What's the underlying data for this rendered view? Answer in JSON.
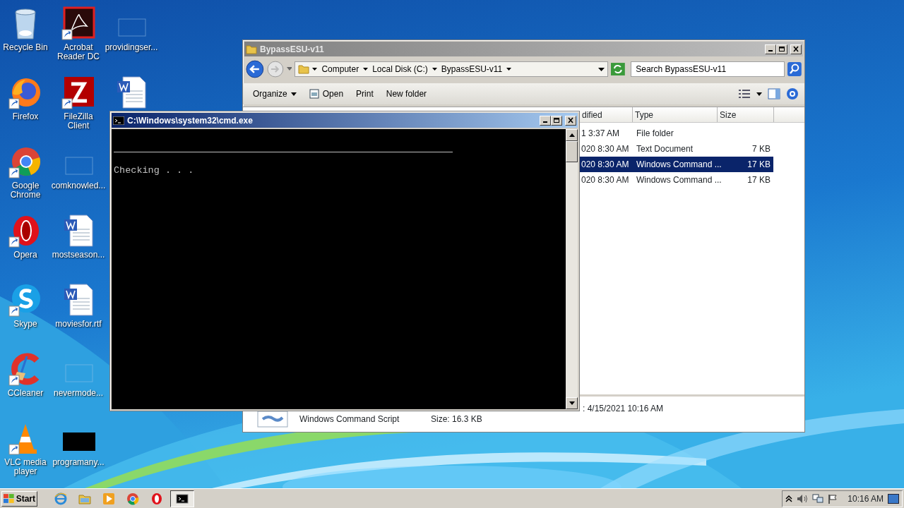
{
  "desktop_columns": [
    {
      "icons": [
        {
          "label": "Recycle Bin",
          "kind": "recycle",
          "shortcut": false
        },
        {
          "label": "Firefox",
          "kind": "firefox",
          "shortcut": true
        },
        {
          "label": "Google Chrome",
          "kind": "chrome",
          "shortcut": true
        },
        {
          "label": "Opera",
          "kind": "opera",
          "shortcut": true
        },
        {
          "label": "Skype",
          "kind": "skype",
          "shortcut": true
        },
        {
          "label": "CCleaner",
          "kind": "ccleaner",
          "shortcut": true
        },
        {
          "label": "VLC media player",
          "kind": "vlc",
          "shortcut": true
        }
      ]
    },
    {
      "icons": [
        {
          "label": "Acrobat Reader DC",
          "kind": "acrobat",
          "shortcut": true
        },
        {
          "label": "FileZilla Client",
          "kind": "filezilla",
          "shortcut": true
        },
        {
          "label": "comknowled...",
          "kind": "blank",
          "shortcut": false
        },
        {
          "label": "mostseason...",
          "kind": "word",
          "shortcut": false
        },
        {
          "label": "moviesfor.rtf",
          "kind": "word",
          "shortcut": false
        },
        {
          "label": "nevermode...",
          "kind": "blank",
          "shortcut": false
        },
        {
          "label": "programany...",
          "kind": "black",
          "shortcut": false
        }
      ]
    },
    {
      "icons": [
        {
          "label": "providingser...",
          "kind": "blank",
          "shortcut": false
        },
        {
          "kind": "word",
          "shortcut": false
        }
      ]
    }
  ],
  "explorer": {
    "title": "BypassESU-v11",
    "breadcrumb": [
      "Computer",
      "Local Disk (C:)",
      "BypassESU-v11"
    ],
    "search": {
      "placeholder": "Search BypassESU-v11"
    },
    "toolbar": [
      {
        "label": "Organize",
        "kind": "menu"
      },
      {
        "label": "Open",
        "kind": "icon"
      },
      {
        "label": "Print",
        "kind": "plain"
      },
      {
        "label": "New folder",
        "kind": "plain"
      }
    ],
    "columns": [
      "dified",
      "Type",
      "Size"
    ],
    "rows": [
      {
        "date": "1 3:37 AM",
        "type": "File folder",
        "selected": false
      },
      {
        "date": "020 8:30 AM",
        "type": "Text Document",
        "size": "7 KB",
        "selected": false
      },
      {
        "date": "020 8:30 AM",
        "type": "Windows Command ...",
        "size": "17 KB",
        "selected": true
      },
      {
        "date": "020 8:30 AM",
        "type": "Windows Command ...",
        "size": "17 KB",
        "selected": false
      }
    ],
    "details": {
      "type": "Windows Command Script",
      "size": "Size: 16.3 KB",
      "date": ": 4/15/2021 10:16 AM"
    }
  },
  "cmd": {
    "title": "C:\\Windows\\system32\\cmd.exe",
    "lines": [
      "Checking . . ."
    ]
  },
  "taskbar": {
    "start": "Start",
    "items": [
      {
        "kind": "ie",
        "active": false
      },
      {
        "kind": "folder",
        "active": false
      },
      {
        "kind": "media",
        "active": false
      },
      {
        "kind": "chrome",
        "active": false
      },
      {
        "kind": "opera",
        "active": false
      },
      {
        "kind": "cmd",
        "active": true
      }
    ],
    "clock": "10:16 AM"
  }
}
